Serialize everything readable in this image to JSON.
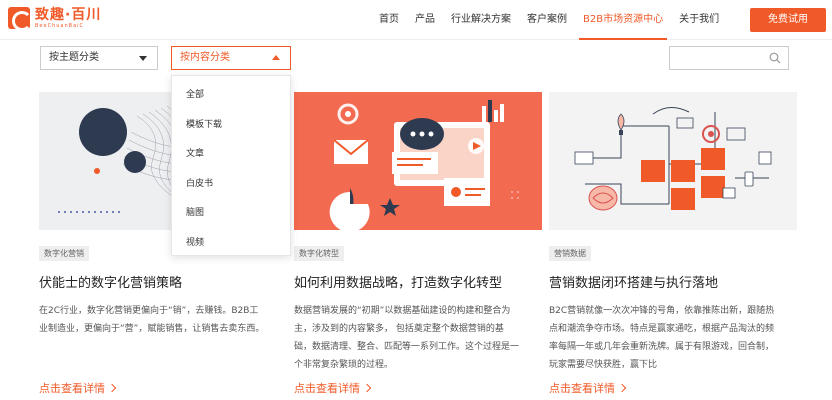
{
  "header": {
    "logo_name": "致趣·百川",
    "logo_sub": "BeeChuanBaiC",
    "nav": [
      "首页",
      "产品",
      "行业解决方案",
      "客户案例",
      "B2B市场资源中心",
      "关于我们"
    ],
    "active_nav": "B2B市场资源中心",
    "trial_label": "免费试用"
  },
  "filters": {
    "topic_label": "按主题分类",
    "content_label": "按内容分类",
    "search_placeholder": ""
  },
  "dropdown": {
    "items": [
      "全部",
      "模板下载",
      "文章",
      "白皮书",
      "脑图",
      "视频"
    ]
  },
  "cards": [
    {
      "tag": "数字化营销",
      "title": "伏能士的数字化营销策略",
      "desc": "在2C行业，数字化营销更偏向于“销”，去赚钱。B2B工业制造业，更偏向于“营”，赋能销售，让销售去卖东西。",
      "more": "点击查看详情"
    },
    {
      "tag": "数字化转型",
      "title": "如何利用数据战略，打造数字化转型",
      "desc": "数据营销发展的“初期”以数据基础建设的构建和整合为主，涉及到的内容繁多， 包括奠定整个数据营销的基础，数据清理、整合、匹配等一系列工作。这个过程是一个非常复杂繁琐的过程。",
      "more": "点击查看详情"
    },
    {
      "tag": "营销数据",
      "title": "营销数据闭环搭建与执行落地",
      "desc": "B2C营销就像一次次冲锋的号角，依靠推陈出新，跟随热点和潮流争夺市场。特点是赢家通吃，根据产品淘汰的频率每隔一年或几年会重新洗牌。属于有限游戏，回合制，玩家需要尽快获胜，赢下比",
      "more": "点击查看详情"
    }
  ],
  "colors": {
    "brand": "#f05a28",
    "card2_bg": "#f26a4f"
  }
}
